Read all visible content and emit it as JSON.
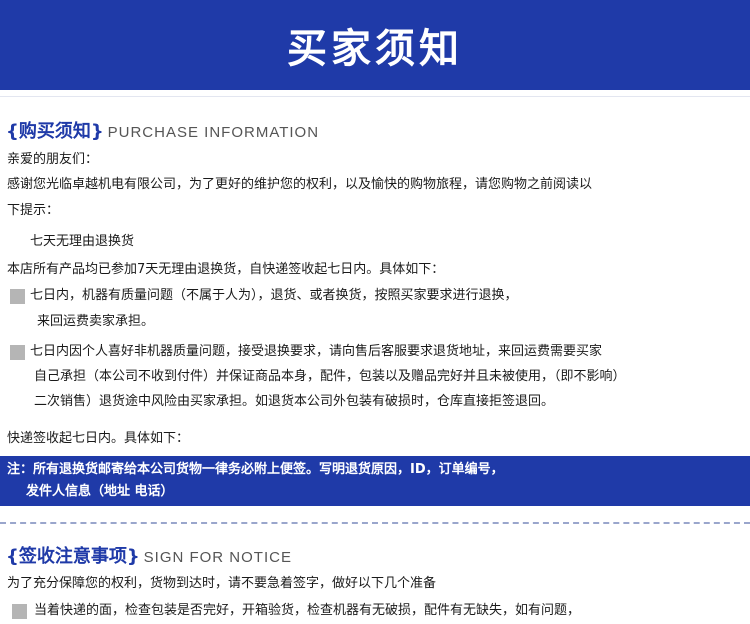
{
  "banner": {
    "title": "买家须知"
  },
  "purchase": {
    "title_cn": "{购买须知}",
    "title_en": "PURCHASE INFORMATION",
    "greeting": "亲爱的朋友们：",
    "intro_1": "感谢您光临卓越机电有限公司，为了更好的维护您的权利，以及愉快的购物旅程，请您购物之前阅读以",
    "intro_2": "下提示：",
    "policy_heading": "七天无理由退换货",
    "policy_desc": "本店所有产品均已参加7天无理由退换货，自快递签收起七日内。具体如下：",
    "item1_line1": "七日内，机器有质量问题（不属于人为），退货、或者换货，按照买家要求进行退换，",
    "item1_line2": "来回运费卖家承担。",
    "item2_line1": "七日内因个人喜好非机器质量问题，接受退换要求，请向售后客服要求退货地址，来回运费需要买家",
    "item2_line2": "自己承担（本公司不收到付件）并保证商品本身，配件，包装以及赠品完好并且未被使用，（即不影响）",
    "item2_line3": "二次销售）退货途中风险由买家承担。如退货本公司外包装有破损时，仓库直接拒签退回。",
    "closing": "快递签收起七日内。具体如下："
  },
  "note": {
    "line1": "注：所有退换货邮寄给本公司货物一律务必附上便签。写明退货原因，ID，订单编号，",
    "line2": "发件人信息（地址 电话）"
  },
  "sign": {
    "title_cn": "{签收注意事项}",
    "title_en": "SIGN FOR NOTICE",
    "intro": "为了充分保障您的权利，货物到达时，请不要急着签字，做好以下几个准备",
    "item1": "当着快递的面，检查包装是否完好，开箱验货，检查机器有无破损，配件有无缺失，如有问题，"
  },
  "colors": {
    "brand_blue": "#1f3aa8",
    "bullet_gray": "#b5b5b5"
  }
}
